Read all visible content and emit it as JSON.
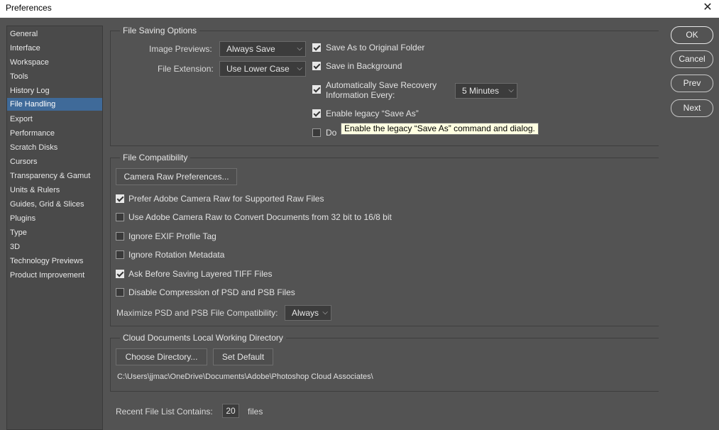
{
  "window": {
    "title": "Preferences",
    "close_icon": "close-icon"
  },
  "sidebar": {
    "selected": "File Handling",
    "items": [
      "General",
      "Interface",
      "Workspace",
      "Tools",
      "History Log",
      "File Handling",
      "Export",
      "Performance",
      "Scratch Disks",
      "Cursors",
      "Transparency & Gamut",
      "Units & Rulers",
      "Guides, Grid & Slices",
      "Plugins",
      "Type",
      "3D",
      "Technology Previews",
      "Product Improvement"
    ]
  },
  "file_saving": {
    "title": "File Saving Options",
    "image_previews": {
      "label": "Image Previews:",
      "value": "Always Save"
    },
    "file_extension": {
      "label": "File Extension:",
      "value": "Use Lower Case"
    },
    "save_as_original": {
      "label": "Save As to Original Folder",
      "checked": true
    },
    "save_in_background": {
      "label": "Save in Background",
      "checked": true
    },
    "auto_save": {
      "label_line1": "Automatically Save Recovery",
      "label_line2": "Information Every:",
      "checked": true,
      "interval": "5 Minutes"
    },
    "legacy_save_as": {
      "label": "Enable legacy “Save As”",
      "checked": true
    },
    "do_not_append": {
      "label_visible": "Do",
      "checked": false
    }
  },
  "tooltip": {
    "text": "Enable the legacy “Save As” command and dialog."
  },
  "file_compat": {
    "title": "File Compatibility",
    "camera_raw_button": "Camera Raw Preferences...",
    "options": [
      {
        "label": "Prefer Adobe Camera Raw for Supported Raw Files",
        "checked": true
      },
      {
        "label": "Use Adobe Camera Raw to Convert Documents from 32 bit to 16/8 bit",
        "checked": false
      },
      {
        "label": "Ignore EXIF Profile Tag",
        "checked": false
      },
      {
        "label": "Ignore Rotation Metadata",
        "checked": false
      },
      {
        "label": "Ask Before Saving Layered TIFF Files",
        "checked": true
      },
      {
        "label": "Disable Compression of PSD and PSB Files",
        "checked": false
      }
    ],
    "maximize": {
      "label": "Maximize PSD and PSB File Compatibility:",
      "value": "Always"
    }
  },
  "cloud": {
    "title": "Cloud Documents Local Working Directory",
    "choose_button": "Choose Directory...",
    "default_button": "Set Default",
    "path": "C:\\Users\\jjmac\\OneDrive\\Documents\\Adobe\\Photoshop Cloud Associates\\"
  },
  "recent": {
    "label": "Recent File List Contains:",
    "value": "20",
    "suffix": "files"
  },
  "buttons": {
    "ok": "OK",
    "cancel": "Cancel",
    "prev": "Prev",
    "next": "Next"
  },
  "colors": {
    "background": "#535353",
    "selected": "#3f6a99",
    "tooltip": "#ffffe1"
  }
}
